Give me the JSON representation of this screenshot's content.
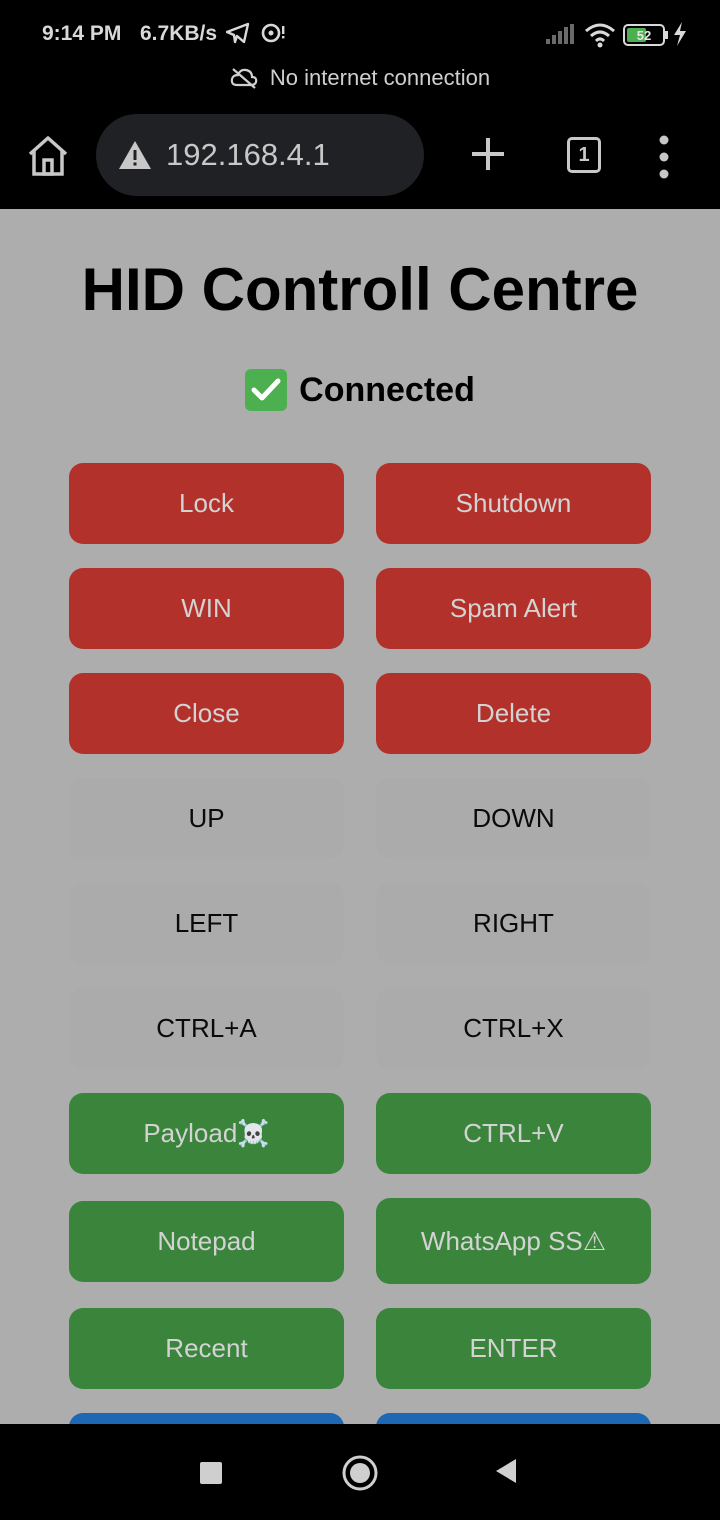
{
  "status_bar": {
    "time": "9:14 PM",
    "speed": "6.7KB/s",
    "battery": "52",
    "offline_message": "No internet connection"
  },
  "toolbar": {
    "url": "192.168.4.1",
    "tab_count": "1"
  },
  "page": {
    "title": "HID Controll Centre",
    "status_text": "Connected",
    "buttons": [
      {
        "label": "Lock",
        "color": "#b3312b"
      },
      {
        "label": "Shutdown",
        "color": "#b3312b"
      },
      {
        "label": "WIN",
        "color": "#b3312b"
      },
      {
        "label": "Spam Alert",
        "color": "#b3312b"
      },
      {
        "label": "Close",
        "color": "#b3312b"
      },
      {
        "label": "Delete",
        "color": "#b3312b"
      },
      {
        "label": "UP",
        "color": "#ababab"
      },
      {
        "label": "DOWN",
        "color": "#ababab"
      },
      {
        "label": "LEFT",
        "color": "#ababab"
      },
      {
        "label": "RIGHT",
        "color": "#ababab"
      },
      {
        "label": "CTRL+A",
        "color": "#ababab"
      },
      {
        "label": "CTRL+X",
        "color": "#ababab"
      },
      {
        "label": "Payload☠️",
        "color": "#3a843c"
      },
      {
        "label": "CTRL+V",
        "color": "#3a843c"
      },
      {
        "label": "Notepad",
        "color": "#3a843c"
      },
      {
        "label": "WhatsApp SS⚠",
        "color": "#3a843c"
      },
      {
        "label": "Recent",
        "color": "#3a843c"
      },
      {
        "label": "ENTER",
        "color": "#3a843c"
      }
    ]
  }
}
